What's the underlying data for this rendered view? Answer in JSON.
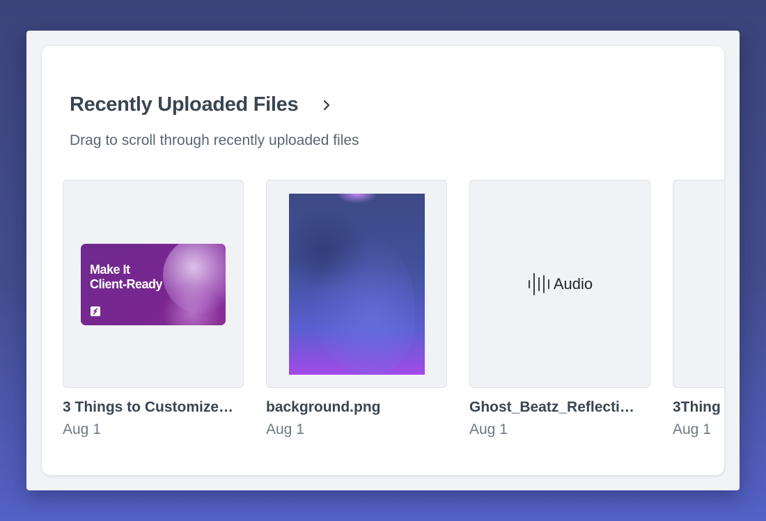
{
  "section": {
    "title": "Recently Uploaded Files",
    "subtitle": "Drag to scroll through recently uploaded files"
  },
  "files": [
    {
      "name": "3 Things to Customize…",
      "date": "Aug 1",
      "thumbnail_text": "Make It\nClient-Ready"
    },
    {
      "name": "background.png",
      "date": "Aug 1"
    },
    {
      "name": "Ghost_Beatz_Reflecti…",
      "date": "Aug 1",
      "thumbnail_label": "Audio",
      "thumbnail_icon": "audio-waveform-icon"
    },
    {
      "name": "3Thing",
      "date": "Aug 1"
    }
  ],
  "colors": {
    "page_background": "#434d8e",
    "title": "#3a4552",
    "subtitle": "#5a6572",
    "thumbnail_background": "#f1f2f5",
    "promo_purple": "#7a2690"
  }
}
